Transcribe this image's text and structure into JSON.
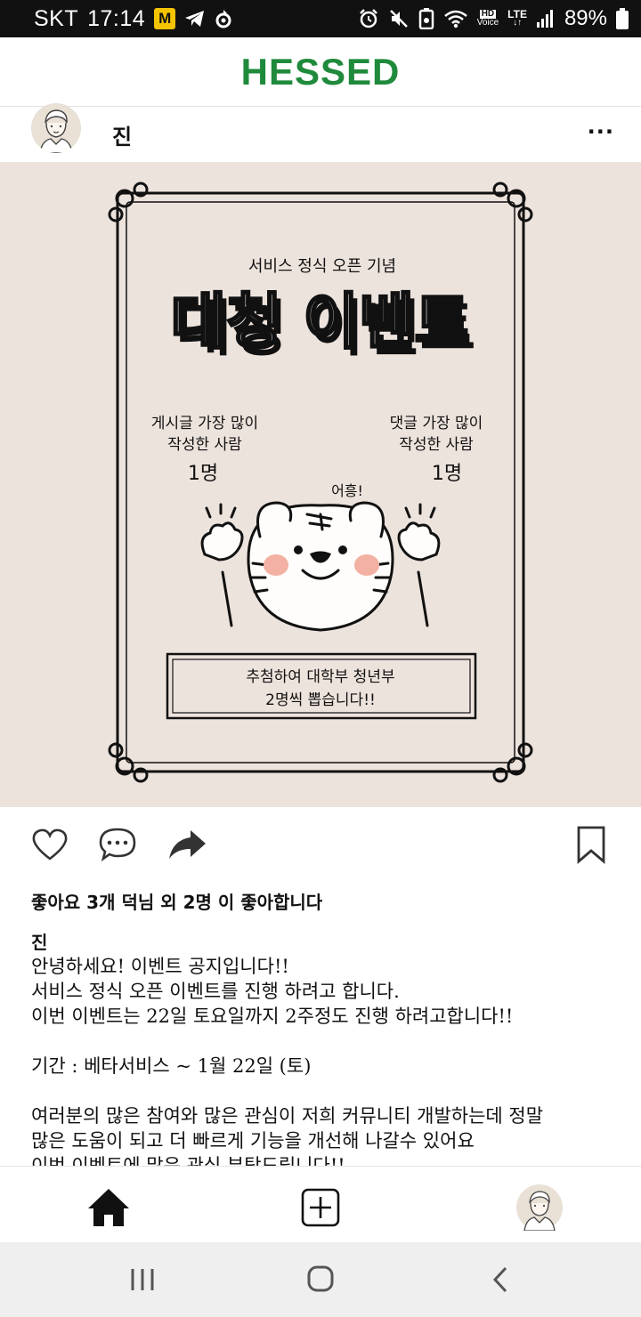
{
  "status_bar": {
    "carrier": "SKT",
    "time": "17:14",
    "badge": "M",
    "hd_label": "HD",
    "voice_label": "Voice",
    "network": "LTE",
    "battery": "89%"
  },
  "app": {
    "title": "HESSED",
    "brand_color": "#1f8a3b"
  },
  "post": {
    "author": "진",
    "more": "···",
    "image": {
      "subtitle": "서비스 정식 오픈 기념",
      "title": "대청 이벤트",
      "left_award_line1": "게시글 가장 많이",
      "left_award_line2": "작성한 사람",
      "left_count": "1명",
      "right_award_line1": "댓글 가장 많이",
      "right_award_line2": "작성한 사람",
      "right_count": "1명",
      "tiger_speech": "어흥!",
      "box_line1": "추첨하여 대학부 청년부",
      "box_line2": "2명씩 뽑습니다!!"
    },
    "likes_text": "좋아요 3개 덕님 외 2명 이 좋아합니다",
    "caption_author": "진",
    "caption_lines": [
      "안녕하세요! 이벤트 공지입니다!!",
      "서비스 정식 오픈 이벤트를 진행 하려고 합니다.",
      "이번 이벤트는 22일 토요일까지 2주정도 진행 하려고합니다!!",
      "",
      "기간 : 베타서비스 ~ 1월 22일 (토)",
      "",
      "여러분의 많은 참여와 많은 관심이 저희 커뮤니티 개발하는데 정말",
      "많은 도움이 되고 더 빠르게 기능을 개선해 나갈수 있어요",
      "이번 이벤트에 많은 관심 부탁드립니다!!"
    ]
  },
  "icons": {
    "like": "heart-icon",
    "comment": "comment-icon",
    "share": "share-icon",
    "bookmark": "bookmark-icon",
    "home": "home-icon",
    "add": "add-post-icon",
    "profile": "avatar"
  }
}
